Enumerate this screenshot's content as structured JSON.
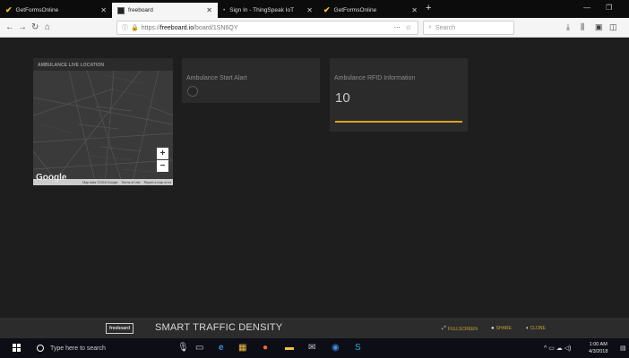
{
  "browser": {
    "tabs": [
      {
        "label": "GetFormsOnline",
        "icon": "check-icon"
      },
      {
        "label": "freeboard",
        "icon": "freeboard-icon"
      },
      {
        "label": "Sign In - ThingSpeak IoT",
        "icon": "dot-icon"
      },
      {
        "label": "GetFormsOnline",
        "icon": "check-icon"
      }
    ],
    "new_tab": "+",
    "url_prefix": "https://",
    "url_host": "freeboard.io",
    "url_path": "/board/1SN6QY",
    "search_placeholder": "Search"
  },
  "widgets": {
    "map": {
      "title": "AMBULANCE LIVE LOCATION",
      "zoom_in": "+",
      "zoom_out": "−",
      "google": "Google",
      "map_data": "Map data ©2018 Google",
      "terms": "Terms of Use",
      "report": "Report a map error"
    },
    "alert": {
      "label": "Ambulance Start Alart",
      "active": false
    },
    "rfid": {
      "label": "Ambulance RFID Information",
      "value": "10"
    }
  },
  "footer": {
    "logo": "freeboard",
    "title": "SMART TRAFFIC DENSITY",
    "fullscreen": "FULLSCREEN",
    "share": "SHARE",
    "clone": "CLONE"
  },
  "taskbar": {
    "search_placeholder": "Type here to search",
    "time": "1:00 AM",
    "date": "4/3/2018"
  },
  "colors": {
    "accent": "#e0a020",
    "background": "#1e1e1e",
    "widget": "#2b2b2b"
  }
}
